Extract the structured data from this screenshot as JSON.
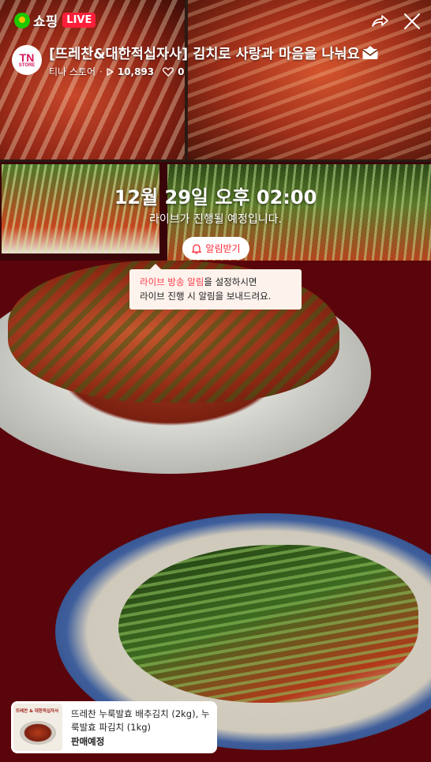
{
  "header": {
    "brand": "쇼핑",
    "live_badge": "LIVE",
    "title": "[뜨레찬&대한적십자사] 김치로 사랑과 마음을 나눠요",
    "channel_name": "티나 스토어",
    "separator": "·",
    "views": "10,893",
    "likes": "0",
    "avatar_line1": "TN",
    "avatar_line2": "STORE"
  },
  "schedule": {
    "datetime": "12월 29일 오후 02:00",
    "message": "라이브가 진행될 예정입니다.",
    "alarm_button": "알림받기"
  },
  "tooltip": {
    "highlight": "라이브 방송 알림",
    "line1_rest": "을 설정하시면",
    "line2": "라이브 진행 시 알림을 보내드려요."
  },
  "product": {
    "name": "뜨레찬 누룩발효 배추김치 (2kg), 누룩발효 파김치 (1kg)",
    "status": "판매예정",
    "thumb_text": "뜨레찬 & 대한적십자사"
  },
  "icons": {
    "share": "share-icon",
    "close": "close-icon",
    "bell": "bell-icon",
    "play": "play-icon",
    "heart": "heart-icon",
    "envelope": "envelope-icon"
  },
  "colors": {
    "live_red": "#ff1f3a",
    "brand_green": "#1ec800",
    "alarm_red": "#ff2a3a",
    "tooltip_bg": "#fdf2ec",
    "background_red": "#5a050b"
  }
}
